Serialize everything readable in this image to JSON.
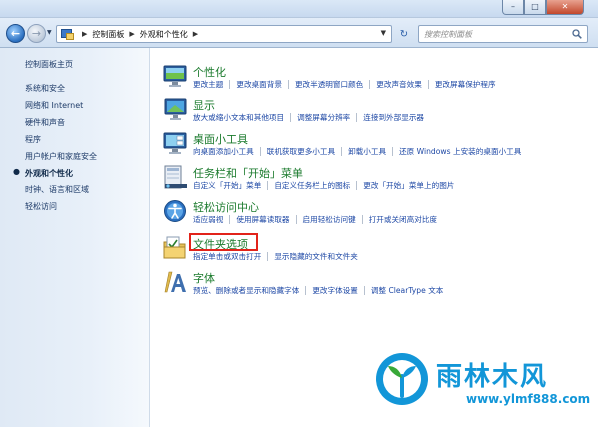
{
  "window": {
    "controls": {
      "minimize": "–",
      "maximize": "□",
      "close": "✕"
    }
  },
  "navbar": {
    "breadcrumbs": [
      "控制面板",
      "外观和个性化"
    ],
    "search_placeholder": "搜索控制面板"
  },
  "sidebar": {
    "items": [
      {
        "label": "控制面板主页",
        "current": false
      },
      {
        "label": "系统和安全",
        "current": false
      },
      {
        "label": "网络和 Internet",
        "current": false
      },
      {
        "label": "硬件和声音",
        "current": false
      },
      {
        "label": "程序",
        "current": false
      },
      {
        "label": "用户帐户和家庭安全",
        "current": false
      },
      {
        "label": "外观和个性化",
        "current": true
      },
      {
        "label": "时钟、语言和区域",
        "current": false
      },
      {
        "label": "轻松访问",
        "current": false
      }
    ]
  },
  "categories": [
    {
      "icon": "personalization-icon",
      "title": "个性化",
      "links": [
        "更改主题",
        "更改桌面背景",
        "更改半透明窗口颜色",
        "更改声音效果",
        "更改屏幕保护程序"
      ]
    },
    {
      "icon": "display-icon",
      "title": "显示",
      "links": [
        "放大或缩小文本和其他项目",
        "调整屏幕分辨率",
        "连接到外部显示器"
      ]
    },
    {
      "icon": "gadgets-icon",
      "title": "桌面小工具",
      "links": [
        "向桌面添加小工具",
        "联机获取更多小工具",
        "卸载小工具",
        "还原 Windows 上安装的桌面小工具"
      ]
    },
    {
      "icon": "taskbar-icon",
      "title": "任务栏和「开始」菜单",
      "links": [
        "自定义「开始」菜单",
        "自定义任务栏上的图标",
        "更改「开始」菜单上的图片"
      ]
    },
    {
      "icon": "ease-of-access-icon",
      "title": "轻松访问中心",
      "links": [
        "适应弱视",
        "使用屏幕读取器",
        "启用轻松访问键",
        "打开或关闭高对比度"
      ]
    },
    {
      "icon": "folder-options-icon",
      "title": "文件夹选项",
      "links": [
        "指定单击或双击打开",
        "显示隐藏的文件和文件夹"
      ]
    },
    {
      "icon": "fonts-icon",
      "title": "字体",
      "links": [
        "预览、删除或者显示和隐藏字体",
        "更改字体设置",
        "调整 ClearType 文本"
      ]
    }
  ],
  "watermark": {
    "title": "雨林木风",
    "url": "www.ylmf888.com"
  },
  "colors": {
    "category_title": "#1a7a2c",
    "link": "#1e48a5",
    "highlight": "#e2231a",
    "watermark": "#1296d8"
  }
}
